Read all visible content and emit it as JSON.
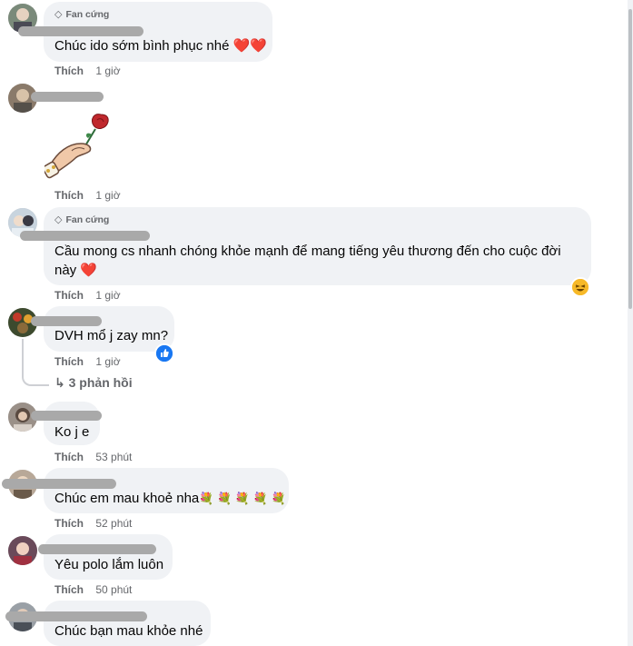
{
  "comments": [
    {
      "badge": "Fan cứng",
      "text": "Chúc ido sớm bình phục nhé",
      "like": "Thích",
      "time": "1 giờ",
      "emoji": "hearts"
    },
    {
      "like": "Thích",
      "time": "1 giờ",
      "sticker": "hand-rose-sticker"
    },
    {
      "badge": "Fan cứng",
      "text_line1": "Cầu mong cs nhanh chóng khỏe mạnh để mang tiếng yêu thương đến cho cuộc đời",
      "text_line2": "này",
      "like": "Thích",
      "time": "1 giờ",
      "reaction": "haha"
    },
    {
      "text": "DVH mổ j zay mn?",
      "like": "Thích",
      "time": "1 giờ",
      "reaction": "like",
      "replies": "3 phản hồi"
    },
    {
      "text": "Ko j e",
      "like": "Thích",
      "time": "53 phút"
    },
    {
      "text": "Chúc em mau khoẻ nha",
      "like": "Thích",
      "time": "52 phút",
      "emoji": "flowers"
    },
    {
      "text": "Yêu polo lắm luôn",
      "like": "Thích",
      "time": "50 phút"
    },
    {
      "text": "Chúc bạn mau khỏe nhé"
    }
  ],
  "colors": {
    "bubble": "#f0f2f5",
    "meta": "#65676b",
    "heart": "#e0143c",
    "like_blue": "#1877f2",
    "haha": "#f7b928"
  }
}
